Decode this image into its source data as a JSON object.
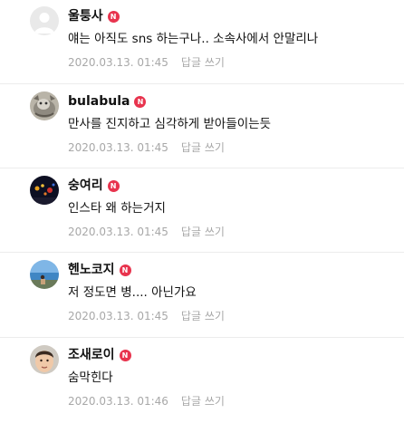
{
  "comments": [
    {
      "username": "울퉁사",
      "badge": "N",
      "text": "얘는 아직도 sns 하는구나.. 소속사에서 안말리나",
      "timestamp": "2020.03.13. 01:45",
      "reply_label": "답글 쓰기",
      "avatar": "default-avatar"
    },
    {
      "username": "bulabula",
      "badge": "N",
      "text": "만사를 진지하고 심각하게 받아들이는듯",
      "timestamp": "2020.03.13. 01:45",
      "reply_label": "답글 쓰기",
      "avatar": "cat-avatar"
    },
    {
      "username": "숭여리",
      "badge": "N",
      "text": "인스타 왜 하는거지",
      "timestamp": "2020.03.13. 01:45",
      "reply_label": "답글 쓰기",
      "avatar": "night-lights-avatar"
    },
    {
      "username": "헨노코지",
      "badge": "N",
      "text": "저 정도면 병.... 아닌가요",
      "timestamp": "2020.03.13. 01:45",
      "reply_label": "답글 쓰기",
      "avatar": "beach-avatar"
    },
    {
      "username": "조새로이",
      "badge": "N",
      "text": "숨막힌다",
      "timestamp": "2020.03.13. 01:46",
      "reply_label": "답글 쓰기",
      "avatar": "face-avatar"
    }
  ]
}
